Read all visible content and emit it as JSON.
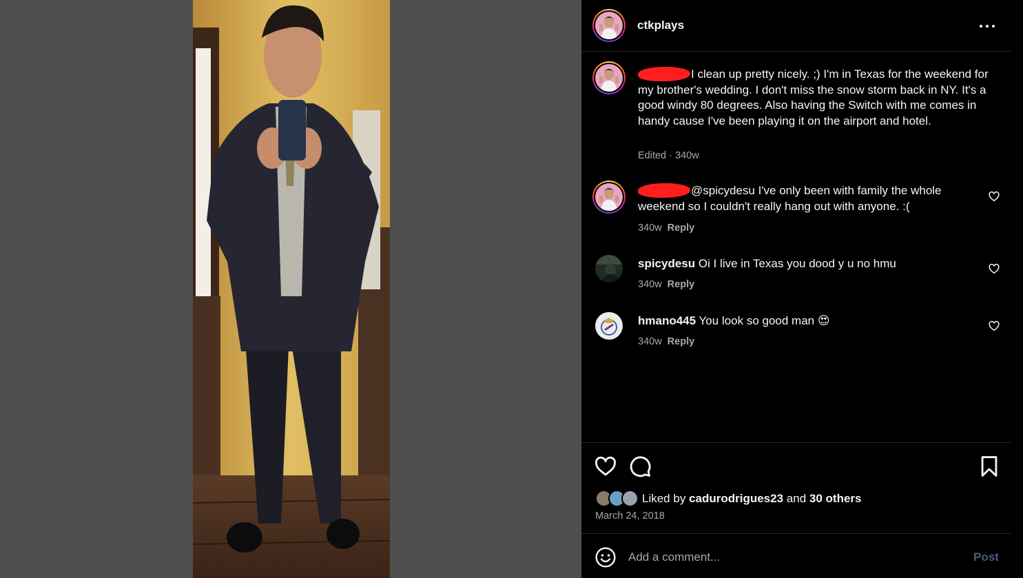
{
  "post": {
    "username": "ctkplays",
    "caption": {
      "text": "I clean up pretty nicely. ;) I'm in Texas for the weekend for my brother's wedding. I don't miss the snow storm back in NY. It's a good windy 80 degrees. Also having the Switch with me comes in handy cause I've been playing it on the airport and hotel.",
      "meta": "Edited · 340w"
    },
    "comments": [
      {
        "username": "",
        "redacted_username": true,
        "text": "@spicydesu I've only been with family the whole weekend so I couldn't really hang out with anyone. :(",
        "time": "340w",
        "reply_label": "Reply"
      },
      {
        "username": "spicydesu",
        "text": "Oi I live in Texas you dood y u no hmu",
        "time": "340w",
        "reply_label": "Reply"
      },
      {
        "username": "hmano445",
        "text": "You look so good man 😍",
        "time": "340w",
        "reply_label": "Reply"
      }
    ],
    "likes": {
      "prefix": "Liked by",
      "first_liker": "cadurodrigues23",
      "conjunction": "and",
      "others": "30 others"
    },
    "date": "March 24, 2018",
    "comment_placeholder": "Add a comment...",
    "post_label": "Post"
  },
  "icons": {
    "more": "more-options-icon",
    "like": "heart-icon",
    "comment": "comment-bubble-icon",
    "save": "bookmark-icon",
    "emoji": "emoji-icon",
    "comment_like": "small-heart-icon"
  },
  "colors": {
    "panel_bg": "#000000",
    "page_bg": "#4f4f4f",
    "text_primary": "#f5f5f5",
    "text_secondary": "#a8a8a8",
    "post_button_inactive": "#4a5d7a",
    "redaction": "#ff1e1e"
  }
}
